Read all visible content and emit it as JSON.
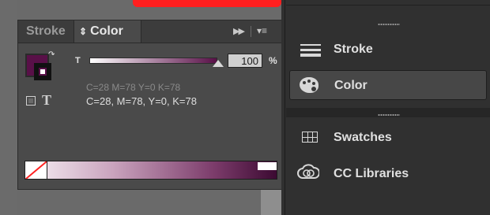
{
  "color_panel": {
    "tabs": [
      {
        "label": "Stroke",
        "active": false
      },
      {
        "label": "Color",
        "active": true
      }
    ],
    "tint_channel": "T",
    "tint_value": "100",
    "percent_symbol": "%",
    "tint_level_fraction": 1.0,
    "color_readout_previous": "C=28 M=78 Y=0 K=78",
    "color_readout": "C=28, M=78, Y=0, K=78",
    "text_toggle_glyph": "T",
    "fill_color": "#591048"
  },
  "dock": {
    "items": [
      {
        "label": "Stroke",
        "icon": "stroke-lines-icon",
        "selected": false
      },
      {
        "label": "Color",
        "icon": "palette-icon",
        "selected": true
      },
      {
        "label": "Swatches",
        "icon": "swatches-grid-icon",
        "selected": false
      },
      {
        "label": "CC Libraries",
        "icon": "cc-libraries-icon",
        "selected": false
      }
    ]
  }
}
